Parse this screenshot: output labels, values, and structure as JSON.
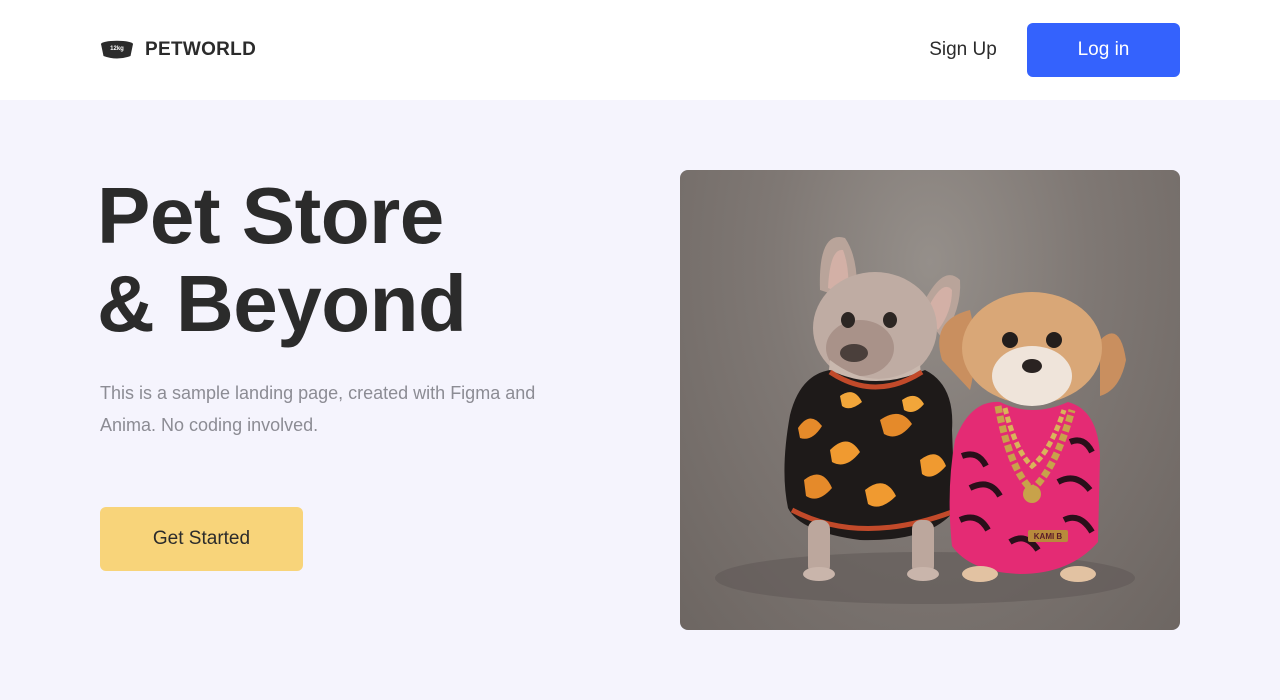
{
  "nav": {
    "brand_name": "PETWORLD",
    "logo_badge": "12kg",
    "signup_label": "Sign Up",
    "login_label": "Log in"
  },
  "hero": {
    "title_line1": "Pet Store",
    "title_line2": "& Beyond",
    "description": "This is a sample landing page, created with Figma and Anima. No coding involved.",
    "cta_label": "Get Started"
  },
  "photo": {
    "tag_text": "KAMI B"
  },
  "colors": {
    "accent": "#3462fd",
    "cta": "#f8d47a",
    "background": "#f5f4fd",
    "nav_background": "#ffffff",
    "text": "#2b2b2b",
    "muted_text": "#8c8c94"
  },
  "icons": {
    "logo": "pet-bowl-icon"
  }
}
